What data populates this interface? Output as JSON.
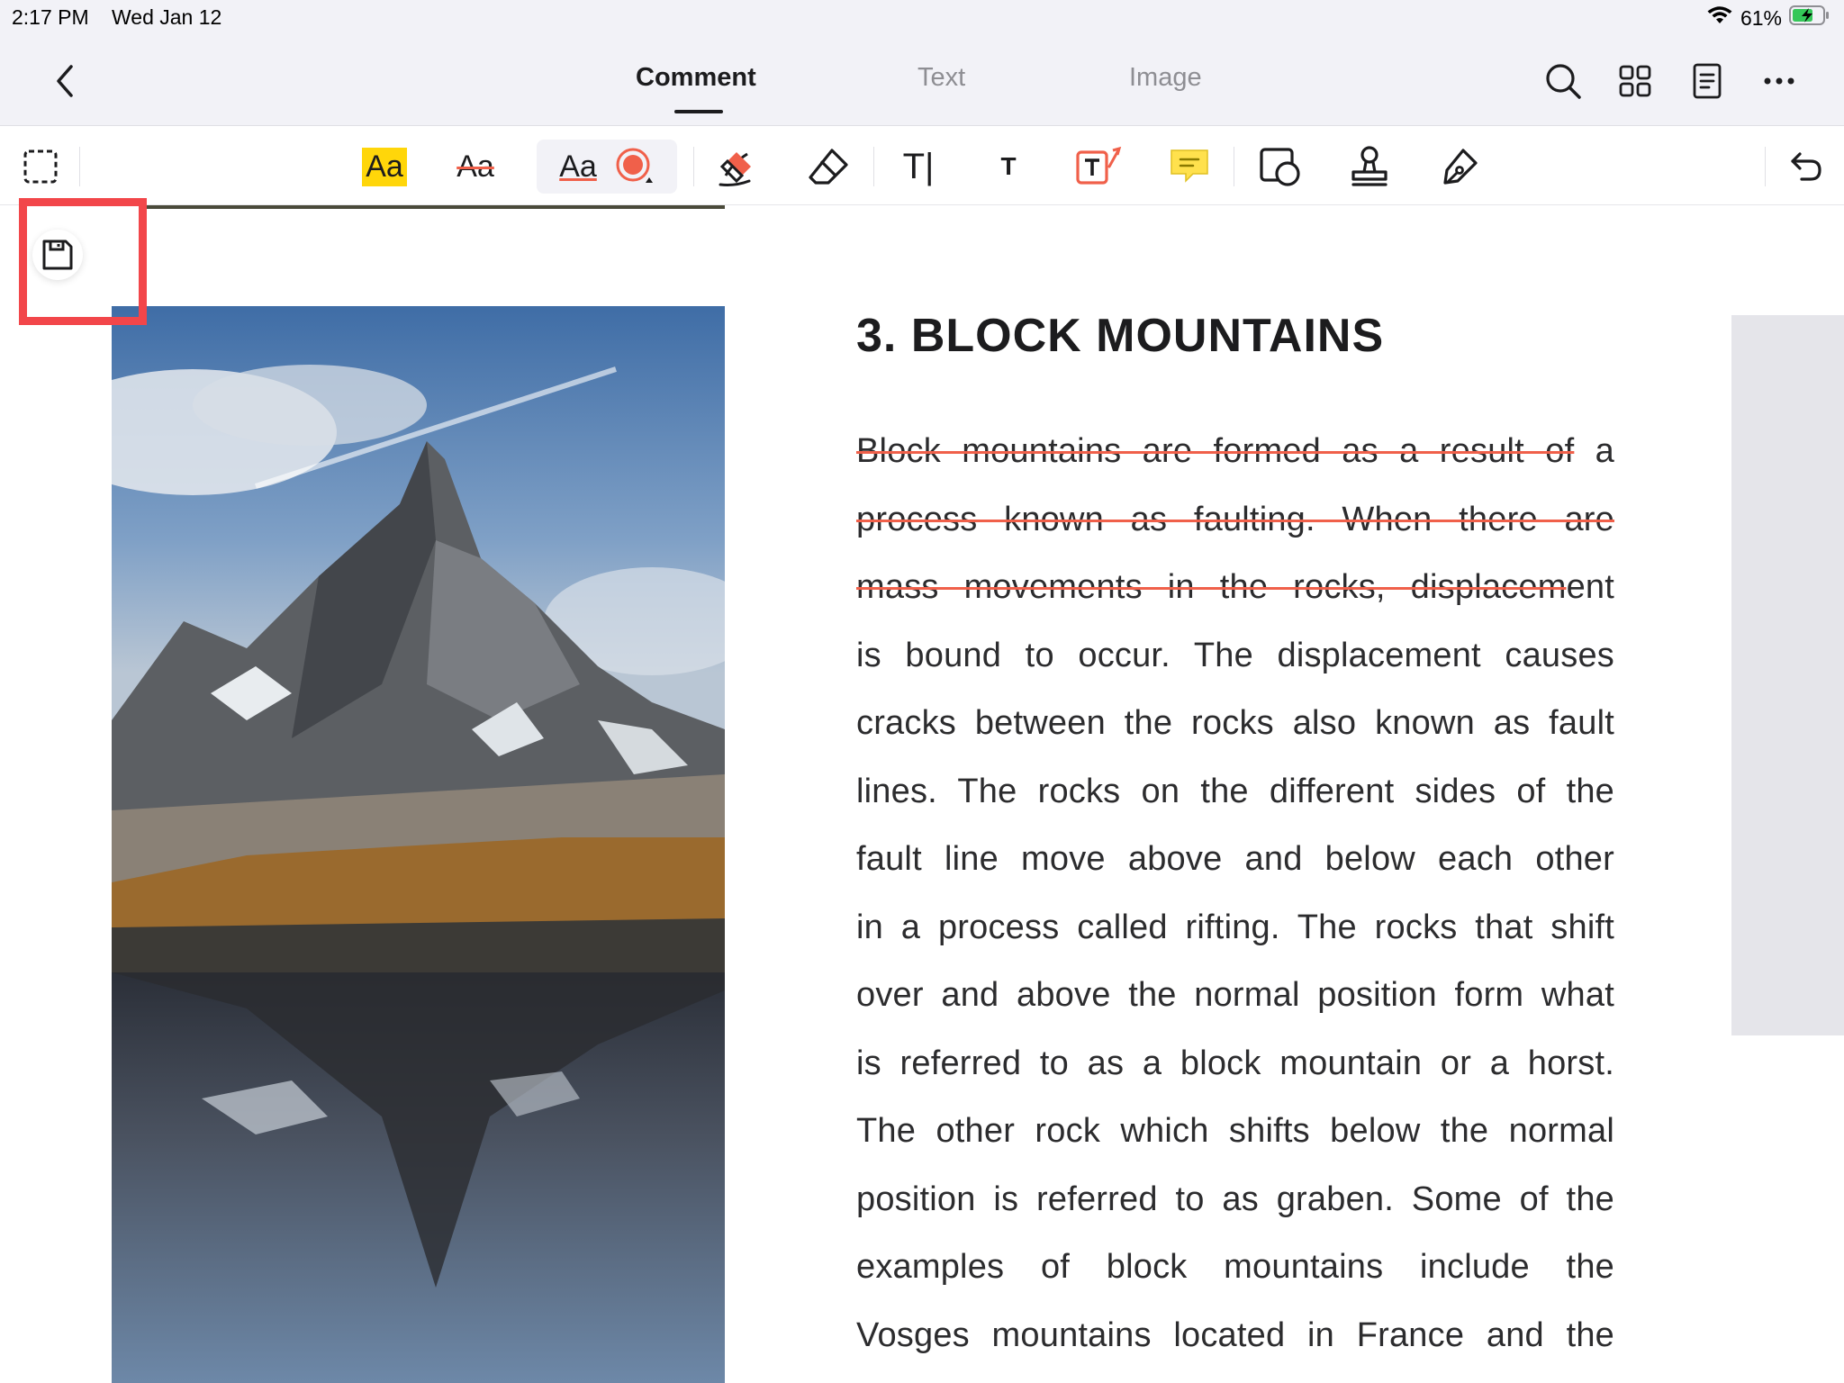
{
  "status_bar": {
    "time": "2:17 PM",
    "date": "Wed Jan 12",
    "battery": "61%"
  },
  "nav": {
    "tabs": [
      {
        "label": "Comment"
      },
      {
        "label": "Text"
      },
      {
        "label": "Image"
      }
    ],
    "icons": [
      "chevron-left-icon",
      "search-icon",
      "grid-icon",
      "document-icon",
      "more-icon"
    ]
  },
  "toolbar": {
    "highlight_label": "Aa",
    "strikeout_label": "Aa",
    "underline_label": "Aa",
    "typewriter_label": "T|",
    "text_label": "T",
    "callout_label": "T",
    "colors": {
      "highlight": "#ffd60a",
      "annotation_red": "#f0604a",
      "note_yellow": "#ffe14d"
    }
  },
  "document": {
    "heading": "3. BLOCK MOUNTAINS",
    "lines": [
      {
        "strike": "Block mountains are formed as a result of",
        "plain": " a"
      },
      {
        "strike": "process known as faulting. When there are",
        "plain": ""
      },
      {
        "strike": "mass movements in the rocks, displacem",
        "plain": "ent"
      },
      {
        "plain": "is bound to occur. The displacement causes"
      },
      {
        "plain": "cracks between the rocks also known as fault"
      },
      {
        "plain": "lines. The rocks on the different sides of the"
      },
      {
        "plain": "fault line move above and below each other"
      },
      {
        "plain": "in a process called rifting. The rocks that shift"
      },
      {
        "plain": "over and above the normal position form what"
      },
      {
        "plain": "is referred to as a block mountain or a horst."
      },
      {
        "plain": "The other rock which shifts below the normal"
      },
      {
        "plain": "position is referred to as graben. Some of the"
      },
      {
        "plain": "examples of block mountains include the"
      },
      {
        "plain": "Vosges mountains located in France and the"
      }
    ]
  }
}
